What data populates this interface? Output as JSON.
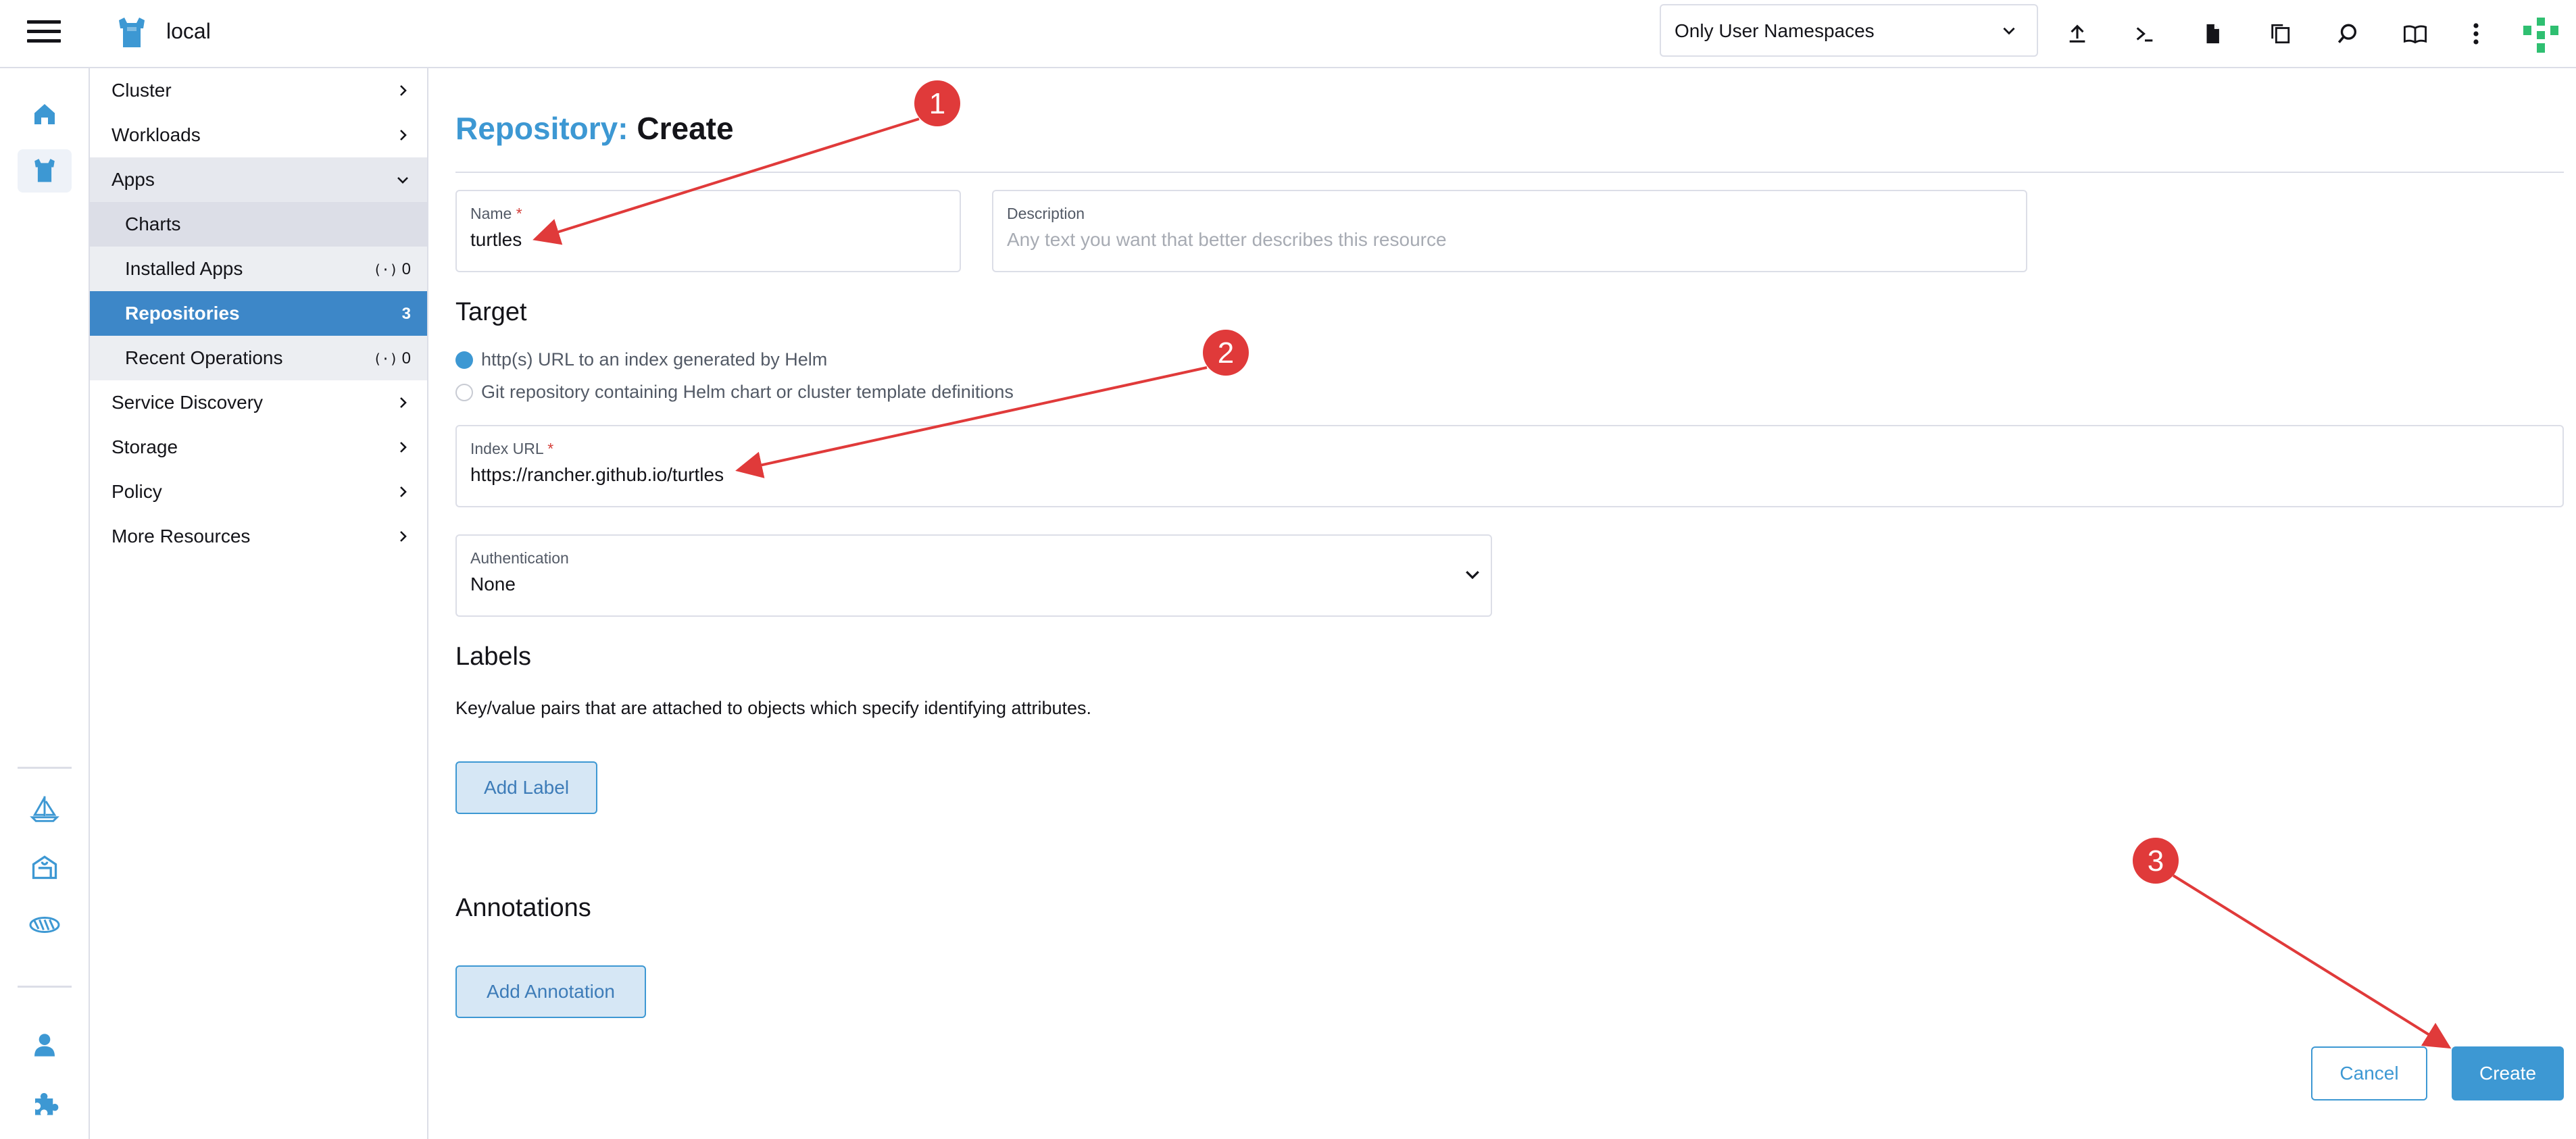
{
  "header": {
    "cluster_name": "local",
    "namespace_filter": "Only User Namespaces",
    "icons": [
      "upload-yaml-icon",
      "kubectl-shell-icon",
      "kubeconfig-download-icon",
      "copy-kubeconfig-icon",
      "resource-search-icon",
      "docs-icon",
      "more-actions-icon"
    ]
  },
  "rail": {
    "top_items": [
      "home-icon",
      "cluster-explorer-icon"
    ],
    "bottom_items": [
      "continuous-delivery-icon",
      "virtualization-icon",
      "cluster-api-icon"
    ],
    "footer_items": [
      "user-account-icon",
      "extensions-icon"
    ]
  },
  "sidenav": {
    "groups": [
      {
        "label": "Cluster"
      },
      {
        "label": "Workloads"
      },
      {
        "label": "Apps"
      },
      {
        "label": "Service Discovery"
      },
      {
        "label": "Storage"
      },
      {
        "label": "Policy"
      },
      {
        "label": "More Resources"
      }
    ],
    "apps_items": [
      {
        "label": "Charts",
        "count": ""
      },
      {
        "label": "Installed Apps",
        "count": "0"
      },
      {
        "label": "Repositories",
        "count": "3"
      },
      {
        "label": "Recent Operations",
        "count": "0"
      }
    ]
  },
  "page": {
    "title_type": "Repository:",
    "title_action": "Create",
    "name_label": "Name",
    "required_mark": "*",
    "name_value": "turtles",
    "description_label": "Description",
    "description_placeholder": "Any text you want that better describes this resource",
    "target_heading": "Target",
    "target_options": [
      {
        "label": "http(s) URL to an index generated by Helm",
        "selected": true
      },
      {
        "label": "Git repository containing Helm chart or cluster template definitions",
        "selected": false
      }
    ],
    "index_url_label": "Index URL",
    "index_url_value": "https://rancher.github.io/turtles",
    "auth_label": "Authentication",
    "auth_value": "None",
    "labels_heading": "Labels",
    "labels_help": "Key/value pairs that are attached to objects which specify identifying attributes.",
    "add_label_button": "Add Label",
    "annotations_heading": "Annotations",
    "add_annotation_button": "Add Annotation",
    "cancel_button": "Cancel",
    "create_button": "Create"
  },
  "annotations": {
    "step_badges": [
      "1",
      "2",
      "3"
    ],
    "color": "#e03a3a"
  },
  "colors": {
    "accent": "#3d98d3",
    "active_nav": "#3d87c8",
    "brand_green": "#2fbf71"
  }
}
